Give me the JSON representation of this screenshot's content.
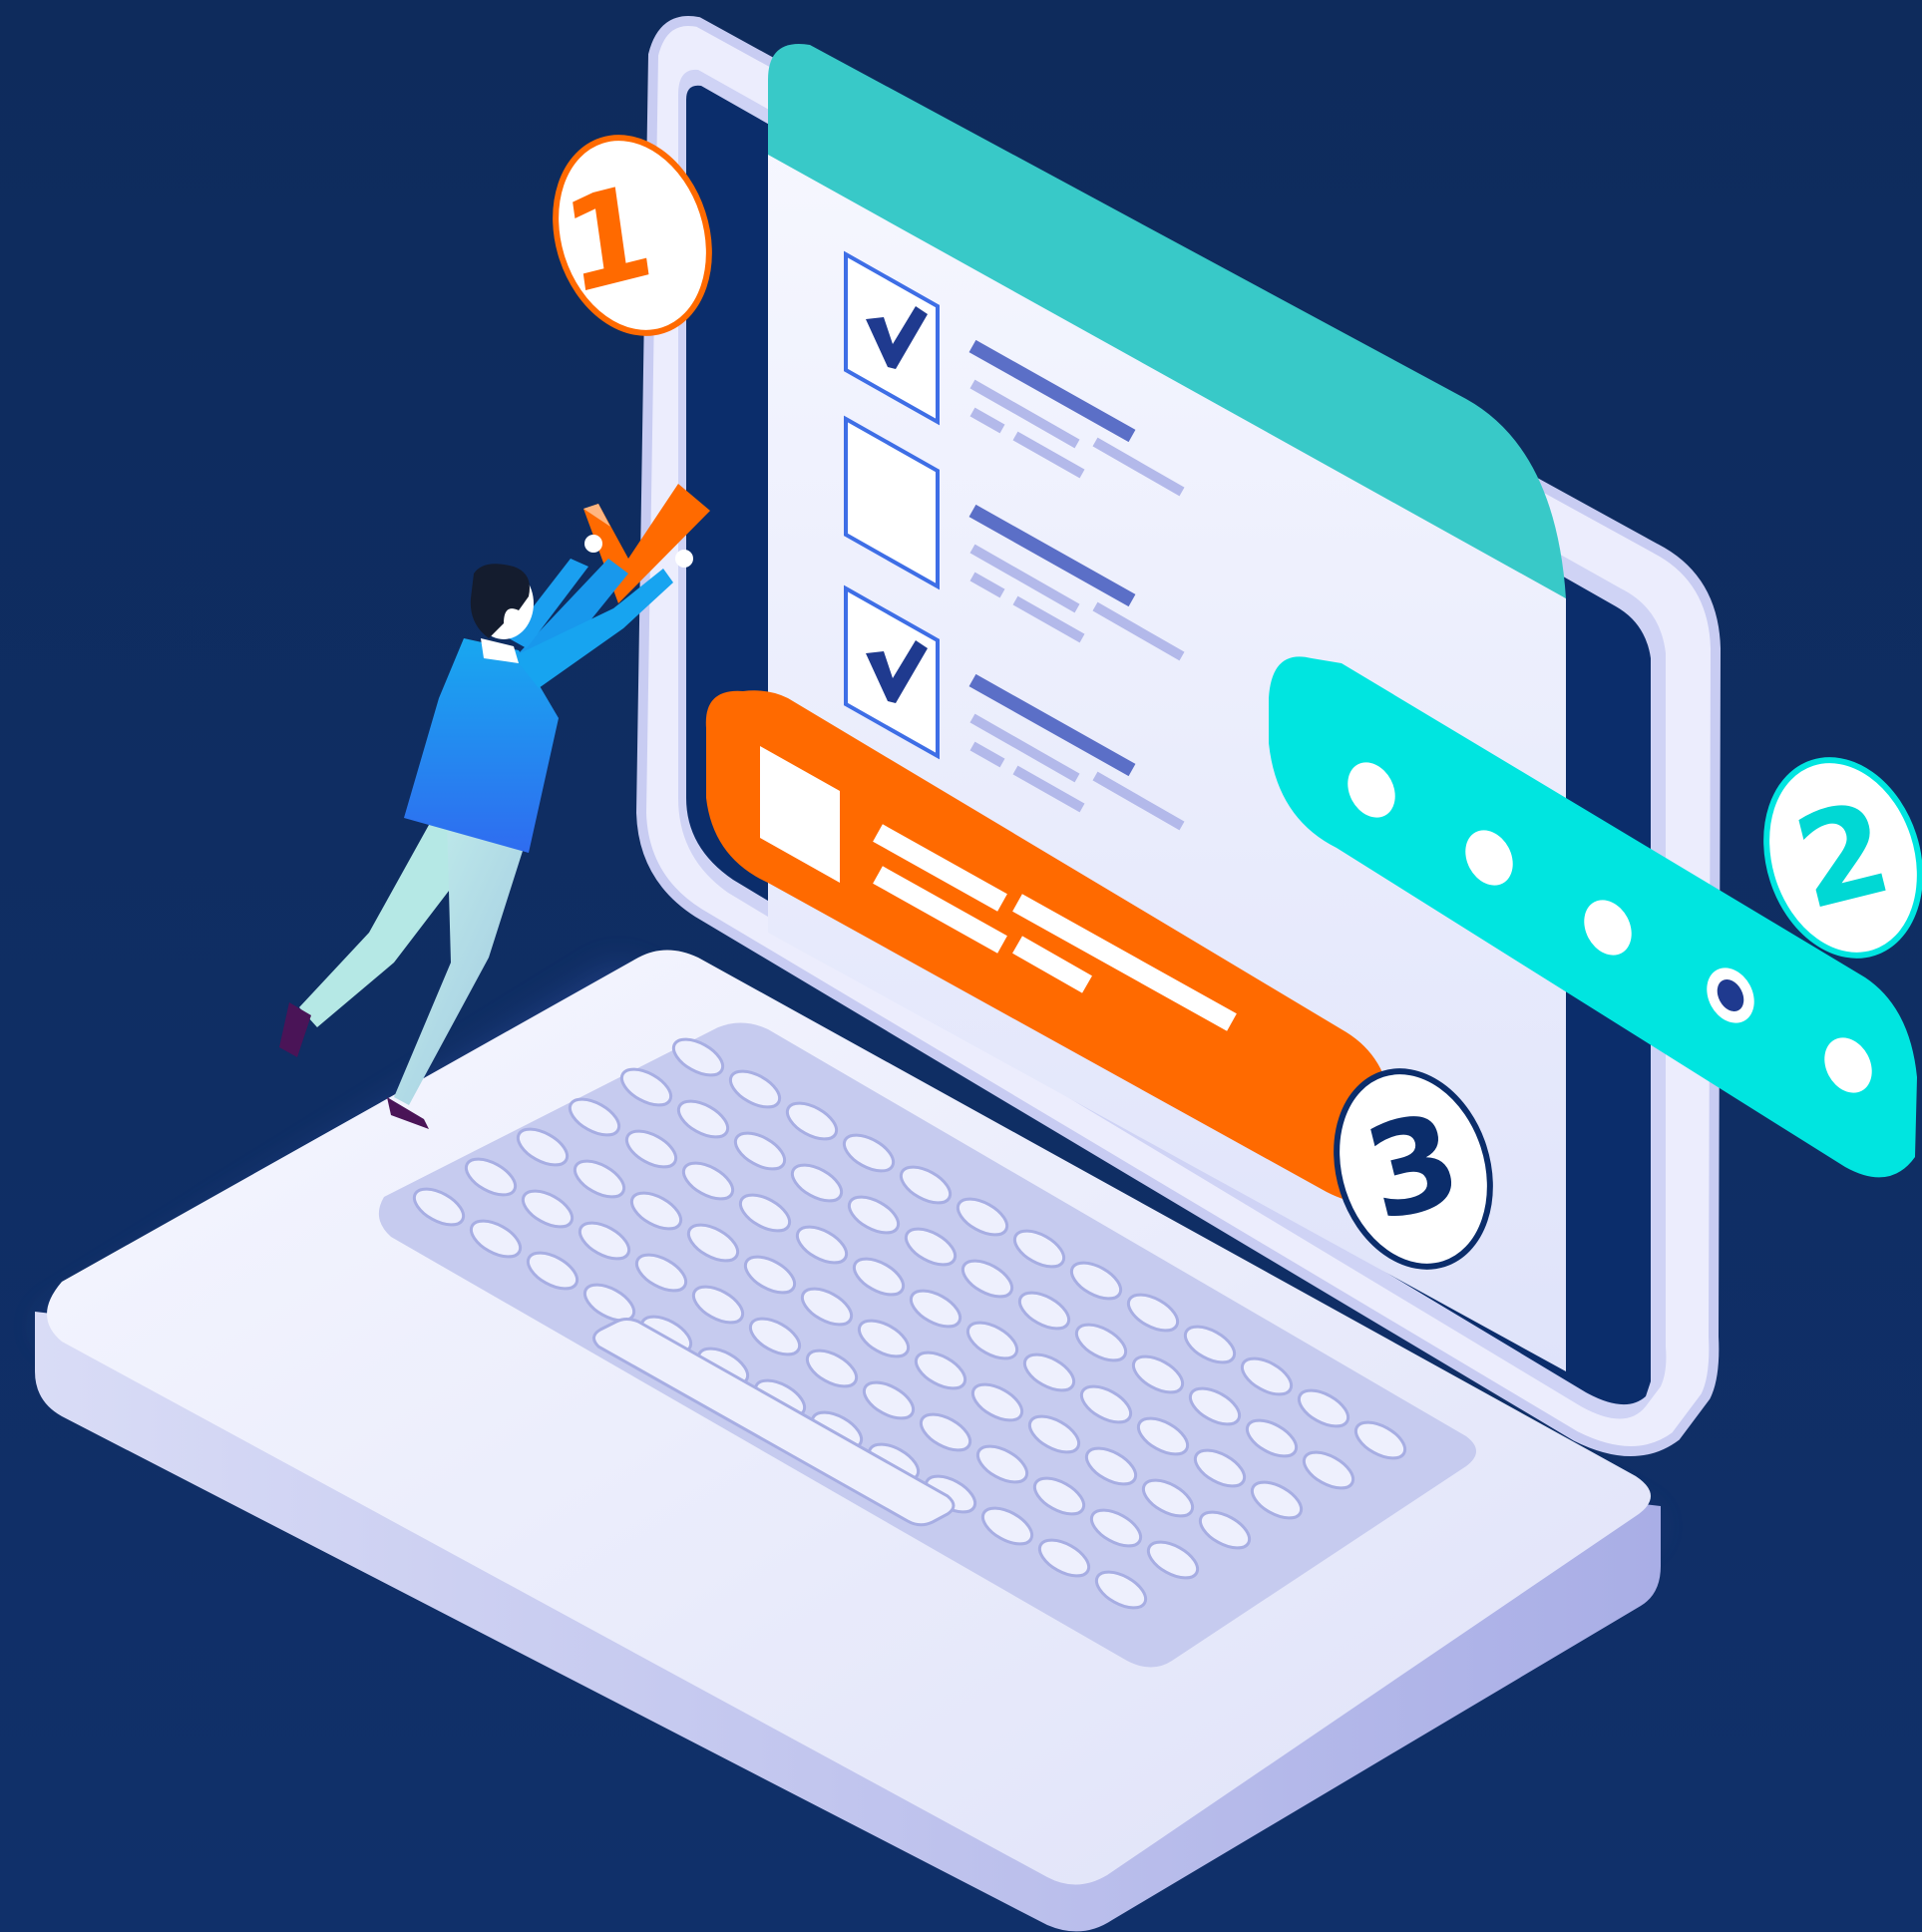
{
  "illustration": {
    "badges": [
      {
        "number": "1"
      },
      {
        "number": "2"
      },
      {
        "number": "3"
      }
    ],
    "checklist": {
      "items": [
        {
          "checked": true
        },
        {
          "checked": false
        },
        {
          "checked": true
        }
      ]
    },
    "colors": {
      "background": "#0f2d5e",
      "teal_header": "#38c9c8",
      "cyan_bar": "#00e5e0",
      "orange": "#ff6a00",
      "checkmark": "#1f3a8f",
      "laptop_body": "#e8eafb",
      "keyboard": "#c6cbef"
    }
  }
}
